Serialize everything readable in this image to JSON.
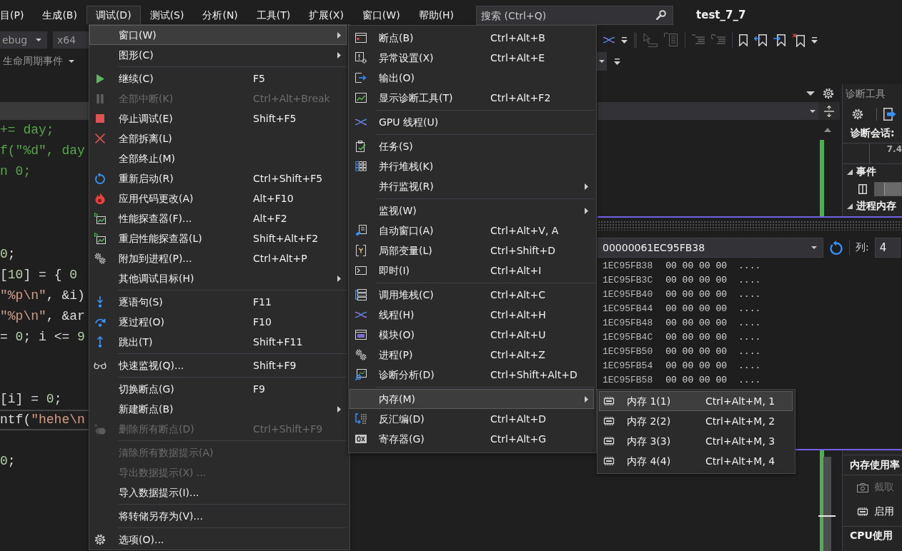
{
  "menu_bar": {
    "items": [
      {
        "label": "目(P)",
        "selected": false
      },
      {
        "label": "生成(B)",
        "selected": false
      },
      {
        "label": "调试(D)",
        "selected": true
      },
      {
        "label": "测试(S)",
        "selected": false
      },
      {
        "label": "分析(N)",
        "selected": false
      },
      {
        "label": "工具(T)",
        "selected": false
      },
      {
        "label": "扩展(X)",
        "selected": false
      },
      {
        "label": "窗口(W)",
        "selected": false
      },
      {
        "label": "帮助(H)",
        "selected": false
      }
    ],
    "search": {
      "placeholder": "搜索 (Ctrl+Q)"
    },
    "title": "test_7_7"
  },
  "toolbar": {
    "configuration": "ebug",
    "platform": "x64"
  },
  "debug_location_bar": {
    "label": "生命周期事件"
  },
  "editor": {
    "lines": [
      {
        "kind": "code",
        "current": false,
        "tokens": [
          {
            "text": "+= day;",
            "kind": "comment"
          }
        ]
      },
      {
        "kind": "code",
        "current": false,
        "tokens": [
          {
            "text": "f(\"%d\", day",
            "kind": "comment"
          }
        ]
      },
      {
        "kind": "code",
        "current": false,
        "tokens": [
          {
            "text": "n 0;",
            "kind": "comment"
          }
        ]
      },
      {
        "kind": "blank",
        "current": false
      },
      {
        "kind": "blank",
        "current": false
      },
      {
        "kind": "blank",
        "current": false
      },
      {
        "kind": "code",
        "current": false,
        "tokens": [
          {
            "text": "0",
            "kind": "number"
          },
          {
            "text": ";",
            "kind": "plain"
          }
        ]
      },
      {
        "kind": "code",
        "current": false,
        "tokens": [
          {
            "text": "[",
            "kind": "plain"
          },
          {
            "text": "10",
            "kind": "number"
          },
          {
            "text": "] = { ",
            "kind": "plain"
          },
          {
            "text": "0",
            "kind": "number"
          }
        ]
      },
      {
        "kind": "code",
        "current": false,
        "tokens": [
          {
            "text": "\"%p\\n\"",
            "kind": "string"
          },
          {
            "text": ", &i)",
            "kind": "plain"
          }
        ]
      },
      {
        "kind": "code",
        "current": false,
        "tokens": [
          {
            "text": "\"%p\\n\"",
            "kind": "string"
          },
          {
            "text": ", &ar",
            "kind": "plain"
          }
        ]
      },
      {
        "kind": "code",
        "current": false,
        "tokens": [
          {
            "text": "= ",
            "kind": "plain"
          },
          {
            "text": "0",
            "kind": "number"
          },
          {
            "text": "; i <= ",
            "kind": "plain"
          },
          {
            "text": "9",
            "kind": "number"
          }
        ]
      },
      {
        "kind": "blank",
        "current": false
      },
      {
        "kind": "blank",
        "current": false
      },
      {
        "kind": "code",
        "current": false,
        "tokens": [
          {
            "text": "[i] = ",
            "kind": "plain"
          },
          {
            "text": "0",
            "kind": "number"
          },
          {
            "text": ";",
            "kind": "plain"
          }
        ]
      },
      {
        "kind": "code",
        "current": true,
        "tokens": [
          {
            "text": "ntf(",
            "kind": "plain"
          },
          {
            "text": "\"hehe\\n",
            "kind": "string"
          }
        ]
      },
      {
        "kind": "blank",
        "current": false
      },
      {
        "kind": "code",
        "current": false,
        "tokens": [
          {
            "text": "0",
            "kind": "number"
          },
          {
            "text": ";",
            "kind": "plain"
          }
        ]
      }
    ]
  },
  "memory_window": {
    "address": "00000061EC95FB38",
    "columns_label": "列:",
    "columns": "4",
    "rows": [
      {
        "address": "1EC95FB38",
        "bytes": "00 00 00 00",
        "text": "...."
      },
      {
        "address": "1EC95FB3C",
        "bytes": "00 00 00 00",
        "text": "...."
      },
      {
        "address": "1EC95FB40",
        "bytes": "00 00 00 00",
        "text": "...."
      },
      {
        "address": "1EC95FB44",
        "bytes": "00 00 00 00",
        "text": "...."
      },
      {
        "address": "1EC95FB48",
        "bytes": "00 00 00 00",
        "text": "...."
      },
      {
        "address": "1EC95FB4C",
        "bytes": "00 00 00 00",
        "text": "...."
      },
      {
        "address": "1EC95FB50",
        "bytes": "00 00 00 00",
        "text": "...."
      },
      {
        "address": "1EC95FB54",
        "bytes": "00 00 00 00",
        "text": "...."
      },
      {
        "address": "1EC95FB58",
        "bytes": "00 00 00 00",
        "text": "...."
      }
    ]
  },
  "diagnostic_tools": {
    "title": "诊断工具",
    "session": "诊断会话:",
    "timeline_label": "7.4",
    "sections": [
      {
        "title": "事件",
        "expanded": true
      },
      {
        "title": "进程内存",
        "expanded": true
      }
    ],
    "panels": [
      {
        "title": "内存使用率",
        "actions": [
          {
            "label": "截取",
            "disabled": true
          },
          {
            "label": "启用",
            "disabled": false
          }
        ]
      },
      {
        "title": "CPU使用"
      }
    ]
  },
  "debug_menu": {
    "groups": [
      [
        {
          "label": "窗口(W)",
          "disabled": false,
          "submenu": true,
          "selected": true
        },
        {
          "label": "图形(C)",
          "disabled": false,
          "submenu": true,
          "selected": false
        }
      ],
      [
        {
          "label": "继续(C)",
          "shortcut": "F5",
          "disabled": false,
          "submenu": false,
          "selected": false
        },
        {
          "label": "全部中断(K)",
          "shortcut": "Ctrl+Alt+Break",
          "disabled": true,
          "submenu": false,
          "selected": false
        },
        {
          "label": "停止调试(E)",
          "shortcut": "Shift+F5",
          "disabled": false,
          "submenu": false,
          "selected": false
        },
        {
          "label": "全部拆离(L)",
          "disabled": false,
          "submenu": false,
          "selected": false
        },
        {
          "label": "全部终止(M)",
          "disabled": false,
          "submenu": false,
          "selected": false
        },
        {
          "label": "重新启动(R)",
          "shortcut": "Ctrl+Shift+F5",
          "disabled": false,
          "submenu": false,
          "selected": false
        },
        {
          "label": "应用代码更改(A)",
          "shortcut": "Alt+F10",
          "disabled": false,
          "submenu": false,
          "selected": false
        },
        {
          "label": "性能探查器(F)...",
          "shortcut": "Alt+F2",
          "disabled": false,
          "submenu": false,
          "selected": false
        },
        {
          "label": "重启性能探查器(L)",
          "shortcut": "Shift+Alt+F2",
          "disabled": false,
          "submenu": false,
          "selected": false
        },
        {
          "label": "附加到进程(P)...",
          "shortcut": "Ctrl+Alt+P",
          "disabled": false,
          "submenu": false,
          "selected": false
        },
        {
          "label": "其他调试目标(H)",
          "disabled": false,
          "submenu": true,
          "selected": false
        }
      ],
      [
        {
          "label": "逐语句(S)",
          "shortcut": "F11",
          "disabled": false,
          "submenu": false,
          "selected": false
        },
        {
          "label": "逐过程(O)",
          "shortcut": "F10",
          "disabled": false,
          "submenu": false,
          "selected": false
        },
        {
          "label": "跳出(T)",
          "shortcut": "Shift+F11",
          "disabled": false,
          "submenu": false,
          "selected": false
        }
      ],
      [
        {
          "label": "快速监视(Q)...",
          "shortcut": "Shift+F9",
          "disabled": false,
          "submenu": false,
          "selected": false
        }
      ],
      [
        {
          "label": "切换断点(G)",
          "shortcut": "F9",
          "disabled": false,
          "submenu": false,
          "selected": false
        },
        {
          "label": "新建断点(B)",
          "disabled": false,
          "submenu": true,
          "selected": false
        },
        {
          "label": "删除所有断点(D)",
          "shortcut": "Ctrl+Shift+F9",
          "disabled": true,
          "submenu": false,
          "selected": false
        }
      ],
      [
        {
          "label": "清除所有数据提示(A)",
          "disabled": true,
          "submenu": false,
          "selected": false
        },
        {
          "label": "导出数据提示(X) ...",
          "disabled": true,
          "submenu": false,
          "selected": false
        },
        {
          "label": "导入数据提示(I)...",
          "disabled": false,
          "submenu": false,
          "selected": false
        }
      ],
      [
        {
          "label": "将转储另存为(V)...",
          "disabled": false,
          "submenu": false,
          "selected": false
        }
      ],
      [
        {
          "label": "选项(O)...",
          "disabled": false,
          "submenu": false,
          "selected": false
        }
      ]
    ]
  },
  "window_submenu": {
    "groups": [
      [
        {
          "label": "断点(B)",
          "shortcut": "Ctrl+Alt+B",
          "submenu": false,
          "selected": false
        },
        {
          "label": "异常设置(X)",
          "shortcut": "Ctrl+Alt+E",
          "submenu": false,
          "selected": false
        },
        {
          "label": "输出(O)",
          "submenu": false,
          "selected": false
        },
        {
          "label": "显示诊断工具(T)",
          "shortcut": "Ctrl+Alt+F2",
          "submenu": false,
          "selected": false
        }
      ],
      [
        {
          "label": "GPU 线程(U)",
          "submenu": false,
          "selected": false
        }
      ],
      [
        {
          "label": "任务(S)",
          "submenu": false,
          "selected": false
        },
        {
          "label": "并行堆栈(K)",
          "submenu": false,
          "selected": false
        },
        {
          "label": "并行监视(R)",
          "submenu": true,
          "selected": false
        }
      ],
      [
        {
          "label": "监视(W)",
          "submenu": true,
          "selected": false
        },
        {
          "label": "自动窗口(A)",
          "shortcut": "Ctrl+Alt+V, A",
          "submenu": false,
          "selected": false
        },
        {
          "label": "局部变量(L)",
          "shortcut": "Ctrl+Shift+D",
          "submenu": false,
          "selected": false
        },
        {
          "label": "即时(I)",
          "shortcut": "Ctrl+Alt+I",
          "submenu": false,
          "selected": false
        }
      ],
      [
        {
          "label": "调用堆栈(C)",
          "shortcut": "Ctrl+Alt+C",
          "submenu": false,
          "selected": false
        },
        {
          "label": "线程(H)",
          "shortcut": "Ctrl+Alt+H",
          "submenu": false,
          "selected": false
        },
        {
          "label": "模块(O)",
          "shortcut": "Ctrl+Alt+U",
          "submenu": false,
          "selected": false
        },
        {
          "label": "进程(P)",
          "shortcut": "Ctrl+Alt+Z",
          "submenu": false,
          "selected": false
        },
        {
          "label": "诊断分析(D)",
          "shortcut": "Ctrl+Shift+Alt+D",
          "submenu": false,
          "selected": false
        }
      ],
      [
        {
          "label": "内存(M)",
          "submenu": true,
          "selected": true
        },
        {
          "label": "反汇编(D)",
          "shortcut": "Ctrl+Alt+D",
          "submenu": false,
          "selected": false
        },
        {
          "label": "寄存器(G)",
          "shortcut": "Ctrl+Alt+G",
          "submenu": false,
          "selected": false
        }
      ]
    ]
  },
  "memory_submenu": {
    "items": [
      {
        "label": "内存 1(1)",
        "shortcut": "Ctrl+Alt+M, 1",
        "selected": true
      },
      {
        "label": "内存 2(2)",
        "shortcut": "Ctrl+Alt+M, 2",
        "selected": false
      },
      {
        "label": "内存 3(3)",
        "shortcut": "Ctrl+Alt+M, 3",
        "selected": false
      },
      {
        "label": "内存 4(4)",
        "shortcut": "Ctrl+Alt+M, 4",
        "selected": false
      }
    ]
  }
}
